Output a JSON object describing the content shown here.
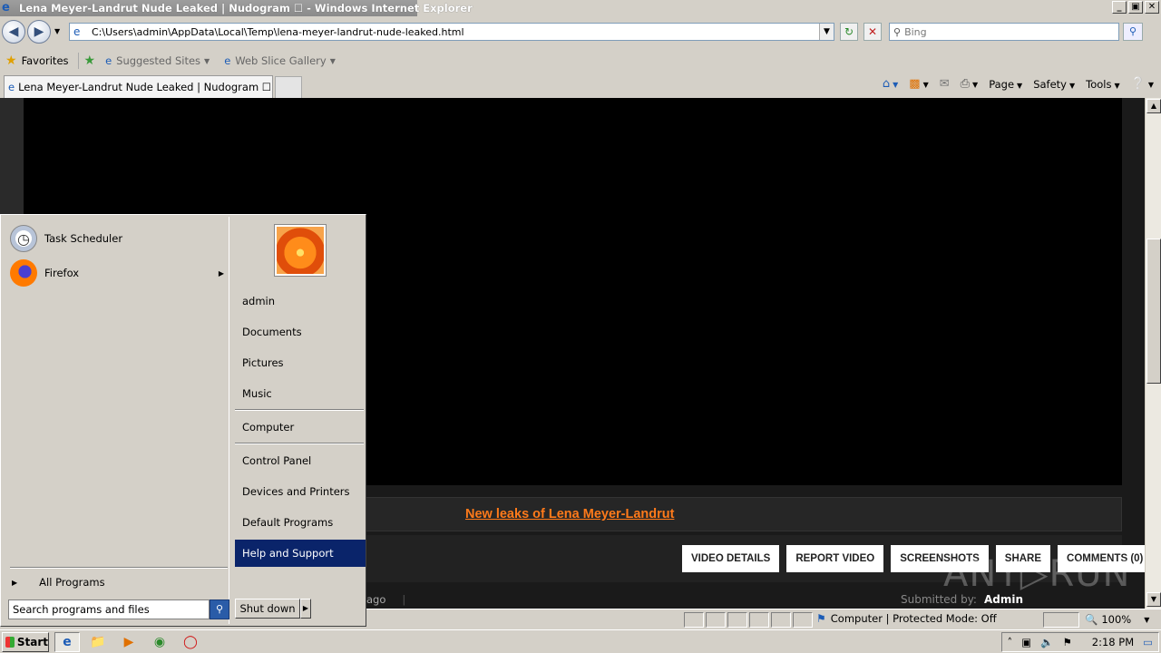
{
  "window": {
    "title": "Lena Meyer-Landrut Nude Leaked | Nudogram ☐ - Windows Internet Explorer",
    "controls": [
      "_",
      "▣",
      "✕"
    ]
  },
  "nav": {
    "url": "C:\\Users\\admin\\AppData\\Local\\Temp\\lena-meyer-landrut-nude-leaked.html",
    "search_placeholder": "Bing"
  },
  "favorites": {
    "favorites_label": "Favorites",
    "suggested_sites_label": "Suggested Sites",
    "web_slice_label": "Web Slice Gallery"
  },
  "tabs": [
    {
      "label": "Lena Meyer-Landrut Nude Leaked | Nudogram ☐"
    }
  ],
  "command_bar": {
    "page_label": "Page",
    "safety_label": "Safety",
    "tools_label": "Tools"
  },
  "page": {
    "leak_link": "New leaks of Lena Meyer-Landrut",
    "buttons": [
      "VIDEO DETAILS",
      "REPORT VIDEO",
      "SCREENSHOTS",
      "SHARE",
      "COMMENTS (0)"
    ],
    "meta_text": "ago",
    "submitted_label": "Submitted by:",
    "submitted_user": "Admin"
  },
  "statusbar": {
    "zone_text": "Computer | Protected Mode: Off",
    "zoom": "100%"
  },
  "start_menu": {
    "programs": [
      {
        "label": "Task Scheduler",
        "icon": "clock-icon"
      },
      {
        "label": "Firefox",
        "icon": "firefox-icon"
      }
    ],
    "all_programs": "All Programs",
    "search_placeholder": "Search programs and files",
    "right_items": [
      "admin",
      "Documents",
      "Pictures",
      "Music",
      "Computer",
      "Control Panel",
      "Devices and Printers",
      "Default Programs",
      "Help and Support"
    ],
    "highlighted": "Help and Support",
    "shutdown_label": "Shut down"
  },
  "taskbar": {
    "start_label": "Start",
    "clock": "2:18 PM"
  },
  "watermark": "ANY▷RUN",
  "colors": {
    "link_orange": "#ff7a1a",
    "highlight_blue": "#0a246a",
    "video_bg": "#000000"
  }
}
